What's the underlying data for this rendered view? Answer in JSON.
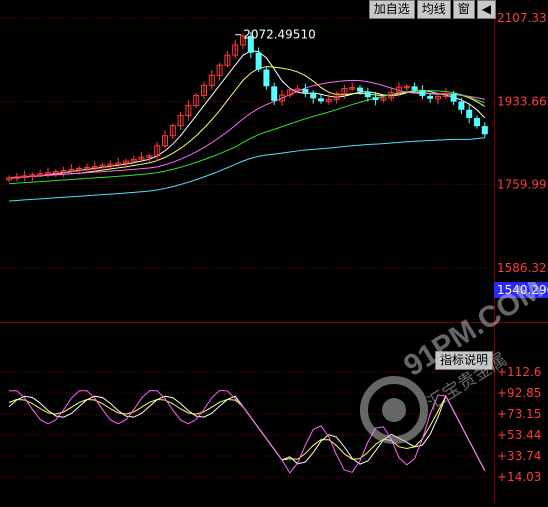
{
  "toolbar": {
    "add_watchlist": "加自选",
    "moving_average": "均线",
    "window": "窗",
    "arrow": "◀"
  },
  "indicator_button": "指标说明",
  "price_axis": {
    "ticks": [
      "2107.333",
      "1933.663",
      "1759.993",
      "1586.323"
    ],
    "current": "1540.290"
  },
  "indicator_axis": {
    "ticks": [
      "+112.6",
      "+92.85",
      "+73.15",
      "+53.44",
      "+33.74",
      "+14.03"
    ]
  },
  "high_marker": "2072.49510",
  "watermark": {
    "brand": "91PM.COM",
    "sub": "汇宝贵金属"
  },
  "colors": {
    "background": "#000000",
    "up_candle": "#ff3b3b",
    "down_candle": "#54ffff",
    "grid": "#7a0000",
    "axis_text": "#ff3b3b",
    "current_price_box": "#2a2aff",
    "ma5": "#ffffff",
    "ma10": "#ffff66",
    "ma20": "#ff66ff",
    "ma30": "#33dd33",
    "ma60": "#55ddff"
  }
}
